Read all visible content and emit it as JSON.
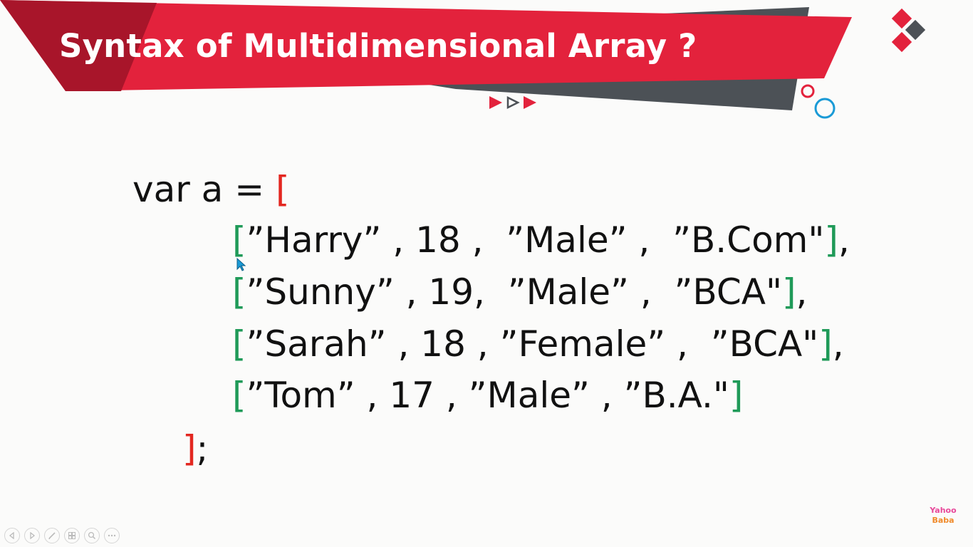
{
  "slide": {
    "title": "Syntax of Multidimensional Array ?",
    "colors": {
      "banner_red": "#e3223c",
      "banner_dark_red": "#a8152a",
      "banner_gray": "#4c5156",
      "bracket_red": "#e32720",
      "bracket_green": "#1f9a58",
      "deco_blue": "#1a9ad6"
    }
  },
  "code": {
    "declaration": "var a = ",
    "open_outer": "[",
    "rows": [
      {
        "open": "[",
        "content": "”Harry” , 18 ,  ”Male” ,  ”B.Com\"",
        "close": "]",
        "suffix": ","
      },
      {
        "open": "[",
        "content": "”Sunny” , 19,  ”Male” ,  ”BCA\"",
        "close": "]",
        "suffix": ","
      },
      {
        "open": "[",
        "content": "”Sarah” , 18 , ”Female” ,  ”BCA\"",
        "close": "]",
        "suffix": ","
      },
      {
        "open": "[",
        "content": "”Tom” , 17 , ”Male” , ”B.A.\"",
        "close": "]",
        "suffix": ""
      }
    ],
    "close_outer": "]",
    "terminator": ";"
  },
  "toolbar": {
    "icons": [
      "previous-icon",
      "next-icon",
      "pen-icon",
      "slides-icon",
      "zoom-icon",
      "more-icon"
    ]
  },
  "watermark": {
    "top": "Yahoo",
    "bottom": "Baba"
  }
}
